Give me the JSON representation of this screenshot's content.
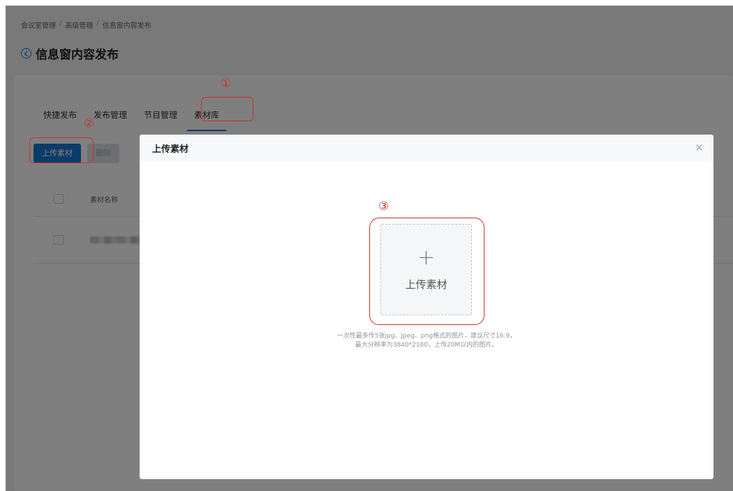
{
  "breadcrumb": {
    "items": [
      "会议室管理",
      "高级管理",
      "信息窗内容发布"
    ],
    "separator": "/"
  },
  "page": {
    "title": "信息窗内容发布",
    "back_icon": "chevron-left-circle-icon"
  },
  "tabs": [
    {
      "label": "快捷发布",
      "active": false
    },
    {
      "label": "发布管理",
      "active": false
    },
    {
      "label": "节目管理",
      "active": false
    },
    {
      "label": "素材库",
      "active": true
    }
  ],
  "toolbar": {
    "upload_label": "上传素材",
    "delete_label": "删除"
  },
  "table": {
    "columns": [
      "素材名称"
    ]
  },
  "modal": {
    "title": "上传素材",
    "upload_box_label": "上传素材",
    "upload_icon": "plus-icon",
    "hint_line1": "一次性最多传5张jpg、jpeg、png格式的图片，建议尺寸16:9，",
    "hint_line2": "最大分辨率为3840*2160，上传20M以内的图片。"
  },
  "annotations": {
    "marker_1": "①",
    "marker_2": "②",
    "marker_3": "③",
    "color": "#c9302c"
  },
  "colors": {
    "primary": "#1677d2",
    "overlay": "rgba(0,0,0,0.5)"
  }
}
